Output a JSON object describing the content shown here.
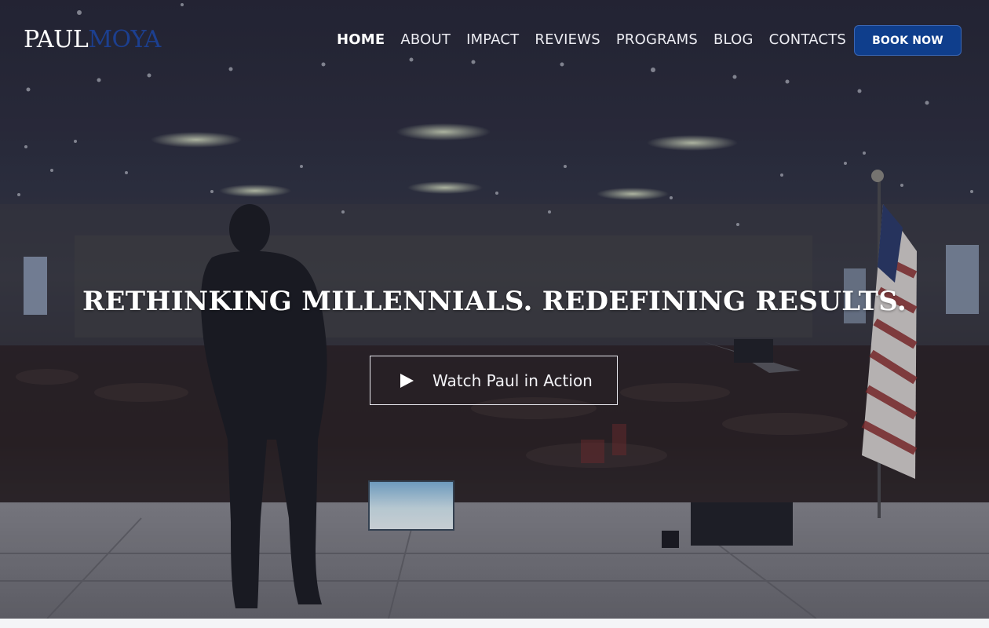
{
  "logo": {
    "first": "PAUL",
    "last": "MOYA"
  },
  "nav": {
    "items": [
      {
        "label": "HOME",
        "active": true
      },
      {
        "label": "ABOUT",
        "active": false
      },
      {
        "label": "IMPACT",
        "active": false
      },
      {
        "label": "REVIEWS",
        "active": false
      },
      {
        "label": "PROGRAMS",
        "active": false
      },
      {
        "label": "BLOG",
        "active": false
      },
      {
        "label": "CONTACTS",
        "active": false
      }
    ],
    "cta": "BOOK NOW"
  },
  "hero": {
    "headline": "RETHINKING MILLENNIALS. REDEFINING RESULTS.",
    "video_button": "Watch Paul in Action"
  },
  "colors": {
    "brand_blue": "#0f3e8c",
    "logo_accent": "#1c3f8f",
    "text_light": "#ffffff"
  },
  "icons": {
    "play": "play-icon"
  }
}
